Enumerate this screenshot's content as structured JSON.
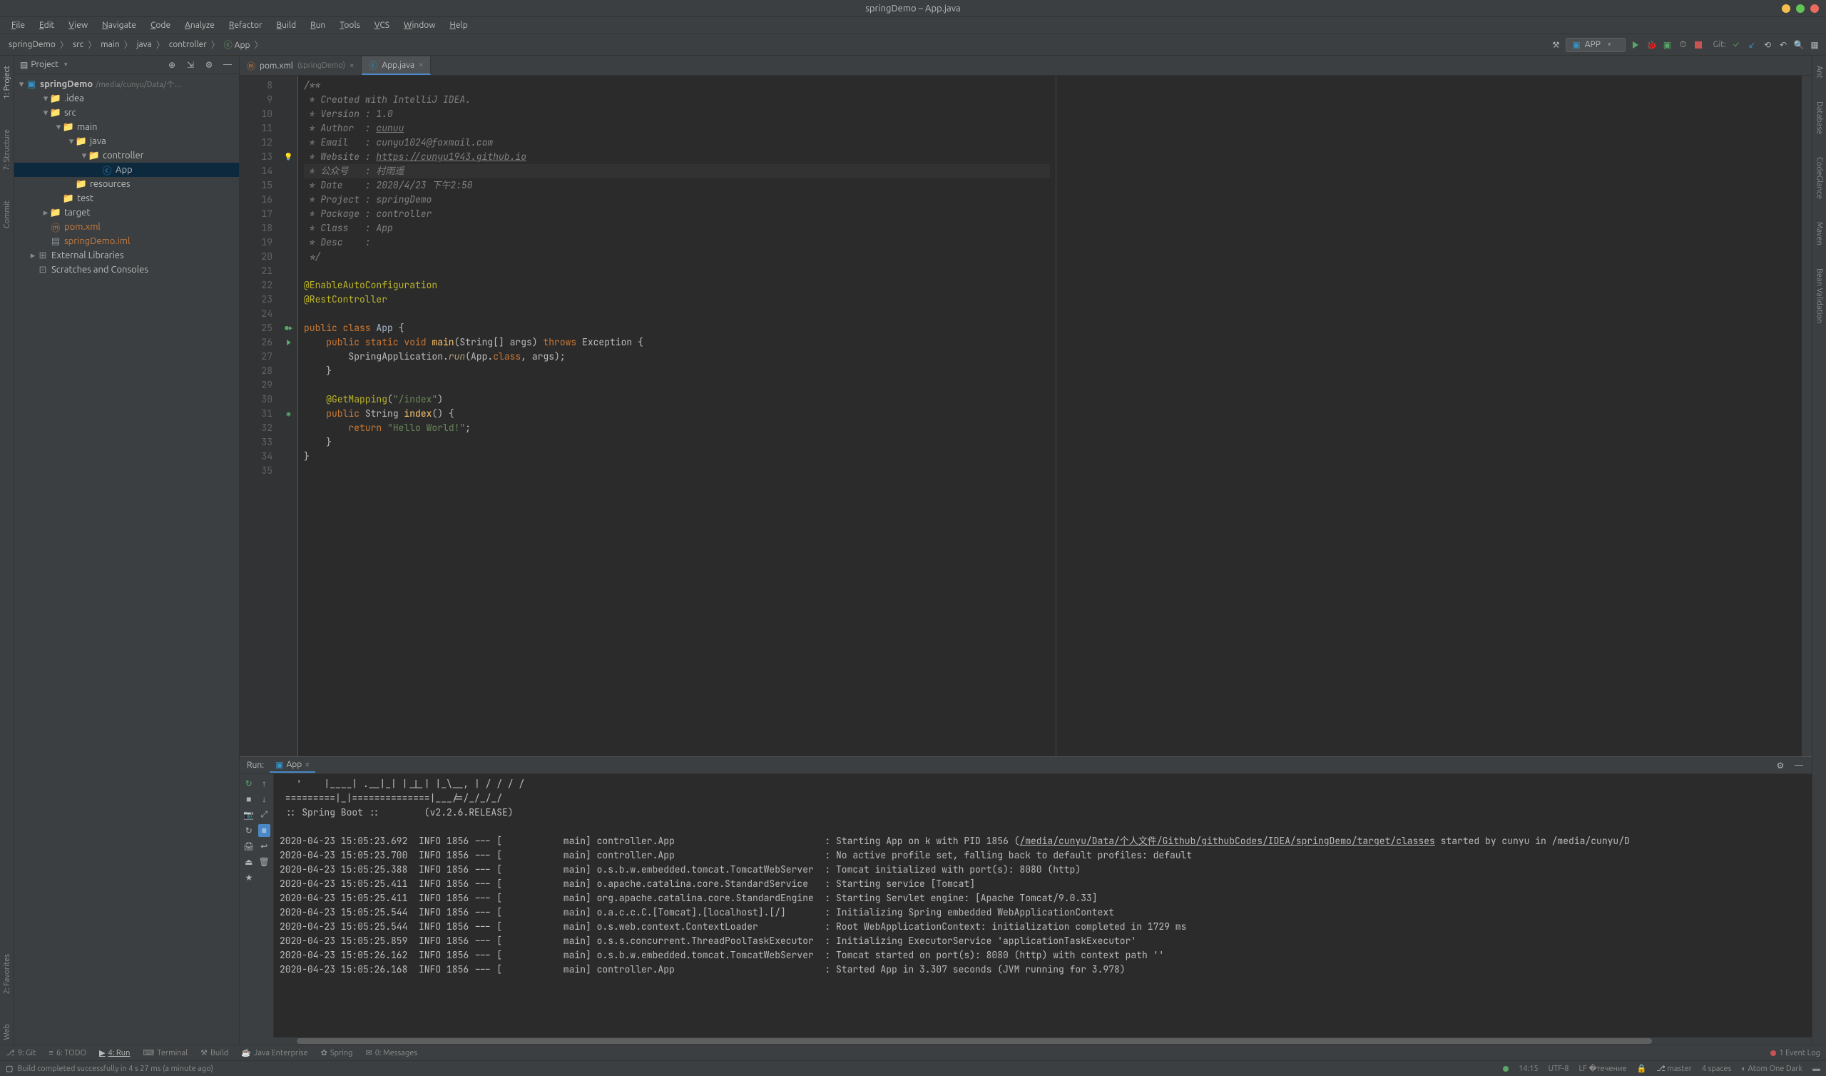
{
  "window": {
    "title": "springDemo – App.java"
  },
  "menu": [
    "File",
    "Edit",
    "View",
    "Navigate",
    "Code",
    "Analyze",
    "Refactor",
    "Build",
    "Run",
    "Tools",
    "VCS",
    "Window",
    "Help"
  ],
  "breadcrumb": [
    "springDemo",
    "src",
    "main",
    "java",
    "controller",
    "App"
  ],
  "runConfig": {
    "name": "APP"
  },
  "navbar": {
    "git_label": "Git:"
  },
  "project": {
    "title": "Project",
    "root": {
      "name": "springDemo",
      "path": "/media/cunyu/Data/个…"
    },
    "items": [
      {
        "indent": 1,
        "arrow": "▾",
        "icon": "folder",
        "label": ".idea"
      },
      {
        "indent": 1,
        "arrow": "▾",
        "icon": "folder-blue",
        "label": "src"
      },
      {
        "indent": 2,
        "arrow": "▾",
        "icon": "folder-blue",
        "label": "main"
      },
      {
        "indent": 3,
        "arrow": "▾",
        "icon": "folder-blue",
        "label": "java"
      },
      {
        "indent": 4,
        "arrow": "▾",
        "icon": "folder",
        "label": "controller"
      },
      {
        "indent": 5,
        "arrow": "",
        "icon": "class",
        "label": "App",
        "selected": true
      },
      {
        "indent": 3,
        "arrow": "",
        "icon": "folder",
        "label": "resources"
      },
      {
        "indent": 2,
        "arrow": "",
        "icon": "folder",
        "label": "test"
      },
      {
        "indent": 1,
        "arrow": "▸",
        "icon": "folder",
        "label": "target"
      },
      {
        "indent": 1,
        "arrow": "",
        "icon": "xml",
        "label": "pom.xml"
      },
      {
        "indent": 1,
        "arrow": "",
        "icon": "file",
        "label": "springDemo.iml"
      },
      {
        "indent": 0,
        "arrow": "▸",
        "icon": "lib",
        "label": "External Libraries"
      },
      {
        "indent": 0,
        "arrow": "",
        "icon": "scratch",
        "label": "Scratches and Consoles"
      }
    ]
  },
  "tabs": [
    {
      "icon": "xml",
      "label": "pom.xml",
      "context": "(springDemo)",
      "active": false
    },
    {
      "icon": "class",
      "label": "App.java",
      "context": "",
      "active": true
    }
  ],
  "code": {
    "startLine": 8,
    "lines": [
      {
        "n": 8,
        "m": "",
        "cls": "",
        "html": "<span class='c-comment'>/**</span>"
      },
      {
        "n": 9,
        "m": "",
        "cls": "",
        "html": "<span class='c-comment'> * Created with IntelliJ IDEA.</span>"
      },
      {
        "n": 10,
        "m": "",
        "cls": "",
        "html": "<span class='c-comment'> * Version : 1.0</span>"
      },
      {
        "n": 11,
        "m": "",
        "cls": "",
        "html": "<span class='c-comment'> * Author  : <span class='c-link'>cunuu</span></span>"
      },
      {
        "n": 12,
        "m": "",
        "cls": "",
        "html": "<span class='c-comment'> * Email   : cunyu1024@foxmail.com</span>"
      },
      {
        "n": 13,
        "m": "💡",
        "cls": "",
        "html": "<span class='c-comment'> * Website : <span class='c-link'>https://cunyu1943.github.io</span></span>"
      },
      {
        "n": 14,
        "m": "",
        "cls": "hl",
        "html": "<span class='c-comment'> * 公众号   : 村雨遥</span>"
      },
      {
        "n": 15,
        "m": "",
        "cls": "",
        "html": "<span class='c-comment'> * Date    : 2020/4/23 下午2:50</span>"
      },
      {
        "n": 16,
        "m": "",
        "cls": "",
        "html": "<span class='c-comment'> * Project : springDemo</span>"
      },
      {
        "n": 17,
        "m": "",
        "cls": "",
        "html": "<span class='c-comment'> * Package : controller</span>"
      },
      {
        "n": 18,
        "m": "",
        "cls": "",
        "html": "<span class='c-comment'> * Class   : App</span>"
      },
      {
        "n": 19,
        "m": "",
        "cls": "",
        "html": "<span class='c-comment'> * Desc    :</span>"
      },
      {
        "n": 20,
        "m": "",
        "cls": "",
        "html": "<span class='c-comment'> */</span>"
      },
      {
        "n": 21,
        "m": "",
        "cls": "",
        "html": ""
      },
      {
        "n": 22,
        "m": "",
        "cls": "",
        "html": "<span class='c-annotation'>@EnableAutoConfiguration</span>"
      },
      {
        "n": 23,
        "m": "",
        "cls": "",
        "html": "<span class='c-annotation'>@RestController</span>"
      },
      {
        "n": 24,
        "m": "",
        "cls": "",
        "html": ""
      },
      {
        "n": 25,
        "m": "⬤▶",
        "cls": "",
        "html": "<span class='c-keyword'>public class </span><span class='c-class'>App</span> {"
      },
      {
        "n": 26,
        "m": "▶",
        "cls": "",
        "html": "    <span class='c-keyword'>public static void </span><span class='c-func'>main</span>(String[] args) <span class='c-keyword'>throws</span> Exception {"
      },
      {
        "n": 27,
        "m": "",
        "cls": "",
        "html": "        SpringApplication.<span class='c-method-call'>run</span>(App.<span class='c-keyword'>class</span>, args);"
      },
      {
        "n": 28,
        "m": "",
        "cls": "",
        "html": "    }"
      },
      {
        "n": 29,
        "m": "",
        "cls": "",
        "html": ""
      },
      {
        "n": 30,
        "m": "",
        "cls": "",
        "html": "    <span class='c-annotation'>@GetMapping</span>(<span class='c-string'>\"/index\"</span>)"
      },
      {
        "n": 31,
        "m": "⬤",
        "cls": "",
        "html": "    <span class='c-keyword'>public </span>String <span class='c-func'>index</span>() {"
      },
      {
        "n": 32,
        "m": "",
        "cls": "",
        "html": "        <span class='c-keyword'>return </span><span class='c-string'>\"Hello World!\"</span>;"
      },
      {
        "n": 33,
        "m": "",
        "cls": "",
        "html": "    }"
      },
      {
        "n": 34,
        "m": "",
        "cls": "",
        "html": "}"
      },
      {
        "n": 35,
        "m": "",
        "cls": "",
        "html": ""
      }
    ]
  },
  "run": {
    "title": "Run:",
    "tab": "App",
    "banner": [
      "   '    |____| .__|_| |_|_| |_\\__, | / / / /",
      " =========|_|==============|___/=/_/_/_/",
      " :: Spring Boot ::        (v2.2.6.RELEASE)",
      ""
    ],
    "log": [
      "2020-04-23 15:05:23.692  INFO 1856 --- [           main] controller.App                           : Starting App on k with PID 1856 (<u>/media/cunyu/Data/个人文件/Github/githubCodes/IDEA/springDemo/target/classes</u> started by cunyu in /media/cunyu/D",
      "2020-04-23 15:05:23.700  INFO 1856 --- [           main] controller.App                           : No active profile set, falling back to default profiles: default",
      "2020-04-23 15:05:25.388  INFO 1856 --- [           main] o.s.b.w.embedded.tomcat.TomcatWebServer  : Tomcat initialized with port(s): 8080 (http)",
      "2020-04-23 15:05:25.411  INFO 1856 --- [           main] o.apache.catalina.core.StandardService   : Starting service [Tomcat]",
      "2020-04-23 15:05:25.411  INFO 1856 --- [           main] org.apache.catalina.core.StandardEngine  : Starting Servlet engine: [Apache Tomcat/9.0.33]",
      "2020-04-23 15:05:25.544  INFO 1856 --- [           main] o.a.c.c.C.[Tomcat].[localhost].[/]       : Initializing Spring embedded WebApplicationContext",
      "2020-04-23 15:05:25.544  INFO 1856 --- [           main] o.s.web.context.ContextLoader            : Root WebApplicationContext: initialization completed in 1729 ms",
      "2020-04-23 15:05:25.859  INFO 1856 --- [           main] o.s.s.concurrent.ThreadPoolTaskExecutor  : Initializing ExecutorService 'applicationTaskExecutor'",
      "2020-04-23 15:05:26.162  INFO 1856 --- [           main] o.s.b.w.embedded.tomcat.TomcatWebServer  : Tomcat started on port(s): 8080 (http) with context path ''",
      "2020-04-23 15:05:26.168  INFO 1856 --- [           main] controller.App                           : Started App in 3.307 seconds (JVM running for 3.978)"
    ]
  },
  "toolWindows": {
    "left": [
      {
        "label": "9: Git",
        "active": false
      },
      {
        "label": "6: TODO",
        "active": false
      },
      {
        "label": "4: Run",
        "active": true
      },
      {
        "label": "Terminal",
        "active": false
      },
      {
        "label": "Build",
        "active": false
      },
      {
        "label": "Java Enterprise",
        "active": false
      },
      {
        "label": "Spring",
        "active": false
      },
      {
        "label": "0: Messages",
        "active": false
      }
    ],
    "right": "1 Event Log"
  },
  "status": {
    "message": "Build completed successfully in 4 s 27 ms (a minute ago)",
    "cursor": "14:15",
    "encoding": "UTF-8",
    "lineSep": "LF",
    "branch": "master",
    "indent": "4 spaces",
    "theme": "Atom One Dark"
  },
  "leftGutter": [
    "1: Project",
    "7: Structure",
    "Commit"
  ],
  "rightGutter": [
    "Ant",
    "Database",
    "CodeGlance",
    "Maven",
    "Bean Validation"
  ],
  "bottomLeftGutter": [
    "2: Favorites",
    "Web"
  ]
}
